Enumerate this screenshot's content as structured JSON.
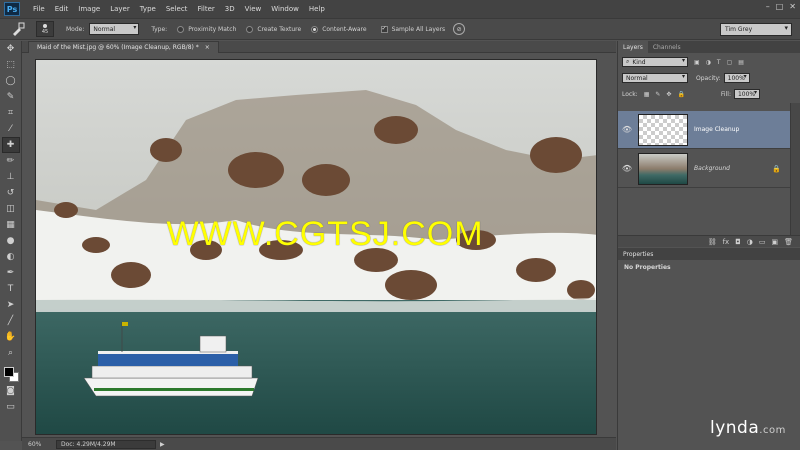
{
  "menubar": {
    "logo": "Ps",
    "items": [
      "File",
      "Edit",
      "Image",
      "Layer",
      "Type",
      "Select",
      "Filter",
      "3D",
      "View",
      "Window",
      "Help"
    ],
    "win_min": "–",
    "win_max": "□",
    "win_close": "✕"
  },
  "options": {
    "brush_size": "45",
    "mode_label": "Mode:",
    "mode_value": "Normal",
    "type_label": "Type:",
    "type_options": [
      "Proximity Match",
      "Create Texture",
      "Content-Aware"
    ],
    "type_selected": 2,
    "sample_all_layers": "Sample All Layers",
    "sample_all_checked": true,
    "workspace": "Tim Grey"
  },
  "document": {
    "tab_title": "Maid of the Mist.jpg @ 60% (Image Cleanup, RGB/8) *",
    "close": "×",
    "watermark": "WWW.CGTSJ.COM"
  },
  "status": {
    "zoom": "60%",
    "doc_info": "Doc: 4.29M/4.29M",
    "arrow": "▶"
  },
  "layers_panel": {
    "tabs": [
      "Layers",
      "Channels"
    ],
    "kind_label": "Kind",
    "blend_mode": "Normal",
    "opacity_label": "Opacity:",
    "opacity_value": "100%",
    "lock_label": "Lock:",
    "fill_label": "Fill:",
    "fill_value": "100%",
    "layers": [
      {
        "name": "Image Cleanup",
        "selected": true,
        "locked": false
      },
      {
        "name": "Background",
        "selected": false,
        "locked": true
      }
    ]
  },
  "properties_panel": {
    "title": "Properties",
    "body": "No Properties"
  },
  "branding": {
    "text": "lynda",
    "suffix": ".com"
  },
  "colors": {
    "foreground": "#000000",
    "background": "#ffffff",
    "selection": "#6d7e98",
    "watermark": "#ffff00"
  }
}
